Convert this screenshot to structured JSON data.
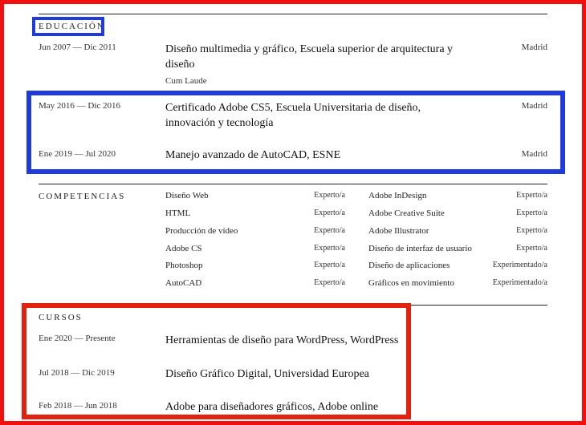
{
  "education": {
    "heading": "EDUCACIÓN",
    "entries": [
      {
        "date": "Jun 2007 — Dic 2011",
        "title": "Diseño multimedia y gráfico, Escuela superior de arquitectura y diseño",
        "note": "Cum Laude",
        "city": "Madrid"
      },
      {
        "date": "May 2016 — Dic 2016",
        "title": "Certificado Adobe CS5, Escuela Universitaria de diseño, innovación y tecnología",
        "city": "Madrid"
      },
      {
        "date": "Ene 2019 — Jul 2020",
        "title": "Manejo avanzado de AutoCAD, ESNE",
        "city": "Madrid"
      }
    ]
  },
  "skills": {
    "heading": "COMPETENCIAS",
    "left": [
      {
        "name": "Diseño Web",
        "level": "Experto/a"
      },
      {
        "name": "HTML",
        "level": "Experto/a"
      },
      {
        "name": "Producción de vídeo",
        "level": "Experto/a"
      },
      {
        "name": "Adobe CS",
        "level": "Experto/a"
      },
      {
        "name": "Photoshop",
        "level": "Experto/a"
      },
      {
        "name": "AutoCAD",
        "level": "Experto/a"
      }
    ],
    "right": [
      {
        "name": "Adobe InDesign",
        "level": "Experto/a"
      },
      {
        "name": "Adobe Creative Suite",
        "level": "Experto/a"
      },
      {
        "name": "Adobe Illustrator",
        "level": "Experto/a"
      },
      {
        "name": "Diseño de interfaz de usuario",
        "level": "Experto/a"
      },
      {
        "name": "Diseño de aplicaciones",
        "level": "Experimentado/a"
      },
      {
        "name": "Gráficos en movimiento",
        "level": "Experimentado/a"
      }
    ]
  },
  "courses": {
    "heading": "CURSOS",
    "entries": [
      {
        "date": "Ene 2020 — Presente",
        "title": "Herramientas de diseño para WordPress, WordPress"
      },
      {
        "date": "Jul 2018 — Dic 2019",
        "title": "Diseño Gráfico Digital, Universidad Europea"
      },
      {
        "date": "Feb 2018 — Jun 2018",
        "title": "Adobe para diseñadores gráficos, Adobe online"
      }
    ]
  },
  "annotation_colors": {
    "outer": "#f20f0f",
    "blue": "#1f3bdc",
    "red": "#e2210f"
  }
}
